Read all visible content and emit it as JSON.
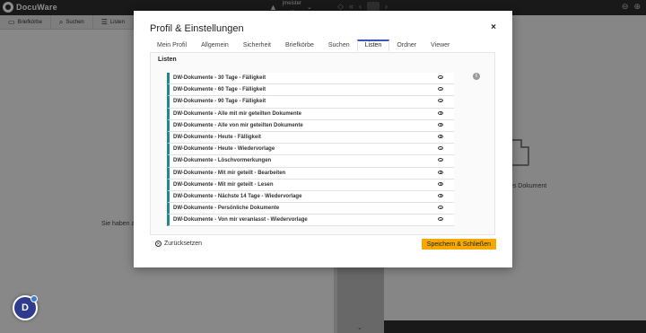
{
  "app": {
    "name": "DocuWare"
  },
  "topbar": {
    "user_name": "jmeister",
    "user_sub": "..."
  },
  "toolbar": {
    "items": [
      {
        "label": "Briefkörbe"
      },
      {
        "label": "Suchen"
      },
      {
        "label": "Listen"
      }
    ]
  },
  "left_pane": {
    "message": "Sie haben al"
  },
  "right_pane": {
    "message": "tes Dokument"
  },
  "dialog": {
    "title": "Profil & Einstellungen",
    "close_label": "×",
    "tabs": [
      {
        "label": "Mein Profil"
      },
      {
        "label": "Allgemein"
      },
      {
        "label": "Sicherheit"
      },
      {
        "label": "Briefkörbe"
      },
      {
        "label": "Suchen"
      },
      {
        "label": "Listen",
        "active": true
      },
      {
        "label": "Ordner"
      },
      {
        "label": "Viewer"
      }
    ],
    "section_title": "Listen",
    "info_label": "i",
    "lists": [
      {
        "label": "DW-Dokumente - 30 Tage - Fälligkeit"
      },
      {
        "label": "DW-Dokumente - 60 Tage - Fälligkeit"
      },
      {
        "label": "DW-Dokumente - 90 Tage - Fälligkeit"
      },
      {
        "label": "DW-Dokumente - Alle mit mir geteilten Dokumente"
      },
      {
        "label": "DW-Dokumente - Alle von mir geteilten Dokumente"
      },
      {
        "label": "DW-Dokumente - Heute - Fälligkeit"
      },
      {
        "label": "DW-Dokumente - Heute - Wiedervorlage"
      },
      {
        "label": "DW-Dokumente - Löschvormerkungen"
      },
      {
        "label": "DW-Dokumente - Mit mir geteilt - Bearbeiten"
      },
      {
        "label": "DW-Dokumente - Mit mir geteilt - Lesen"
      },
      {
        "label": "DW-Dokumente - Nächste 14 Tage - Wiedervorlage"
      },
      {
        "label": "DW-Dokumente - Persönliche Dokumente"
      },
      {
        "label": "DW-Dokumente - Von mir veranlasst - Wiedervorlage"
      }
    ],
    "reset_label": "Zurücksetzen",
    "save_label": "Speichern & Schließen"
  },
  "colors": {
    "accent": "#3a58b0",
    "list_marker": "#1f8a8a",
    "save_button": "#f5a800",
    "topbar": "#2f2f2f"
  }
}
